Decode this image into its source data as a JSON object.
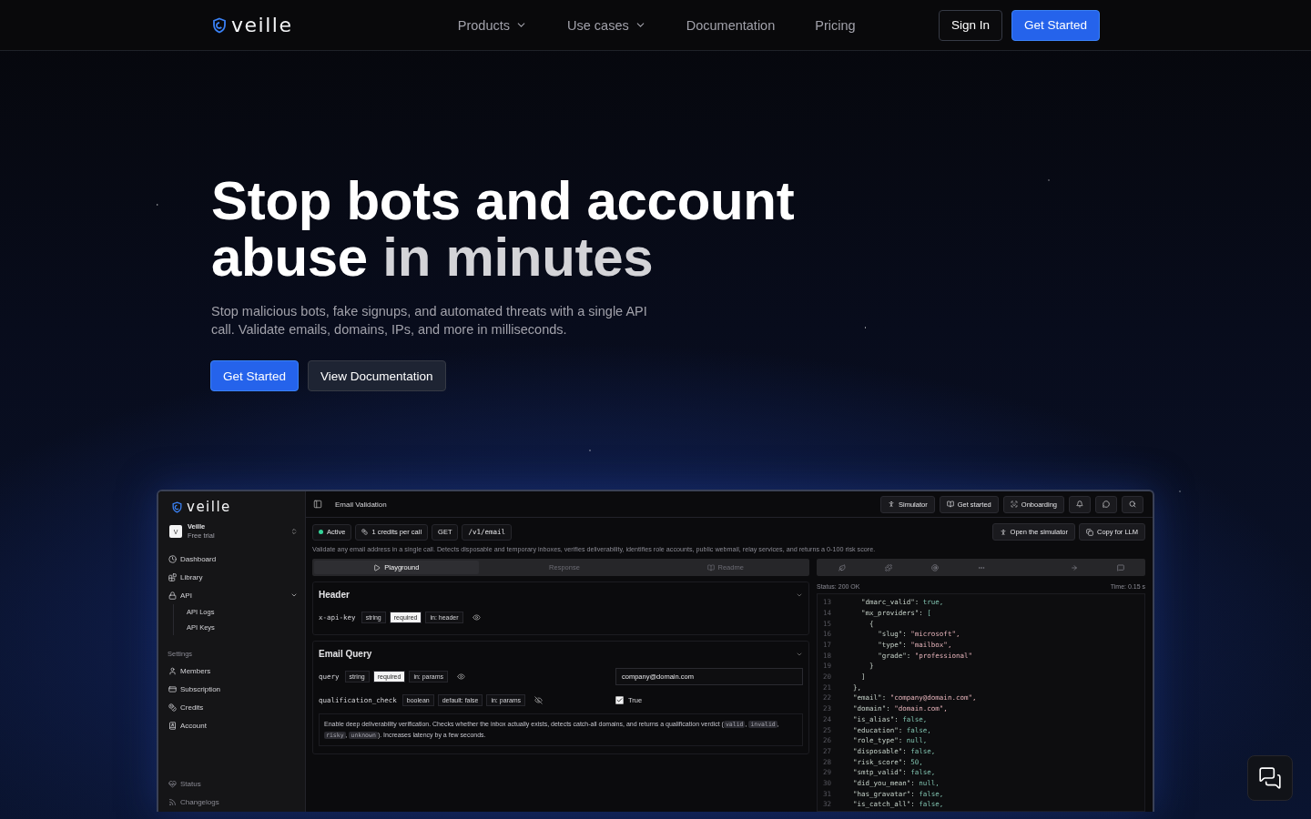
{
  "nav": {
    "logo": "veille",
    "links": [
      {
        "label": "Products",
        "dropdown": true
      },
      {
        "label": "Use cases",
        "dropdown": true
      },
      {
        "label": "Documentation",
        "dropdown": false
      },
      {
        "label": "Pricing",
        "dropdown": false
      }
    ],
    "sign_in": "Sign In",
    "cta": "Get Started"
  },
  "hero": {
    "title": [
      {
        "text": "Stop bots and account abuse",
        "kind": "plain"
      },
      {
        "text": "in minutes",
        "kind": "highlight"
      }
    ],
    "subtitle": "Stop malicious bots, fake signups, and automated threats with a single API call. Validate emails, domains, IPs, and more in milliseconds.",
    "buttons": [
      {
        "label": "Get Started",
        "kind": "primary"
      },
      {
        "label": "View Documentation",
        "kind": "secondary"
      }
    ]
  },
  "app": {
    "sidebar": {
      "logo": "veille",
      "workspace": {
        "avatar": "V",
        "name": "Veille",
        "plan": "Free trial"
      },
      "items": [
        {
          "label": "Dashboard"
        },
        {
          "label": "Library"
        },
        {
          "label": "API",
          "expanded": true,
          "children": [
            {
              "label": "API Logs"
            },
            {
              "label": "API Keys"
            }
          ]
        }
      ],
      "settings_label": "Settings",
      "settings": [
        {
          "label": "Members"
        },
        {
          "label": "Subscription"
        },
        {
          "label": "Credits"
        },
        {
          "label": "Account"
        }
      ],
      "footer": [
        {
          "label": "Status"
        },
        {
          "label": "Changelogs"
        }
      ]
    },
    "topbar": {
      "title": "Email Validation",
      "buttons": [
        {
          "label": "Simulator"
        },
        {
          "label": "Get started"
        },
        {
          "label": "Onboarding"
        }
      ]
    },
    "badges": [
      {
        "kind": "status",
        "text": "Active"
      },
      {
        "kind": "credits",
        "text": "1 credits per call"
      },
      {
        "kind": "plain",
        "text": "GET"
      },
      {
        "kind": "mono",
        "text": "/v1/email"
      }
    ],
    "actions": [
      {
        "label": "Open the simulator"
      },
      {
        "label": "Copy for LLM"
      }
    ],
    "description": "Validate any email address in a single call. Detects disposable and temporary inboxes, verifies deliverability, identifies role accounts, public webmail, relay services, and returns a 0-100 risk score.",
    "tabs": [
      {
        "label": "Playground",
        "selected": true
      },
      {
        "label": "Response",
        "selected": false
      },
      {
        "label": "Readme",
        "selected": false
      }
    ],
    "sections": [
      {
        "title": "Header",
        "params": [
          {
            "name": "x-api-key",
            "tags": [
              {
                "text": "string",
                "kind": "plain"
              },
              {
                "text": "required",
                "kind": "required"
              },
              {
                "text": "in: header",
                "kind": "plain"
              }
            ],
            "visible": true
          }
        ]
      },
      {
        "title": "Email Query",
        "params": [
          {
            "name": "query",
            "tags": [
              {
                "text": "string",
                "kind": "plain"
              },
              {
                "text": "required",
                "kind": "required"
              },
              {
                "text": "in: params",
                "kind": "plain"
              }
            ],
            "visible": true,
            "kind": "text",
            "value": "company@domain.com"
          },
          {
            "name": "qualification_check",
            "tags": [
              {
                "text": "boolean",
                "kind": "plain"
              },
              {
                "text": "default: false",
                "kind": "plain"
              },
              {
                "text": "in: params",
                "kind": "plain"
              }
            ],
            "visible": false,
            "kind": "checkbox",
            "checked": true,
            "check_label": "True",
            "description": [
              {
                "kind": "text",
                "text": "Enable deep deliverability verification. Checks whether the inbox actually exists, detects catch-all domains, and returns a qualification verdict ("
              },
              {
                "kind": "code",
                "text": "valid"
              },
              {
                "kind": "text",
                "text": ", "
              },
              {
                "kind": "code",
                "text": "invalid"
              },
              {
                "kind": "text",
                "text": ", "
              },
              {
                "kind": "code",
                "text": "risky"
              },
              {
                "kind": "text",
                "text": ", "
              },
              {
                "kind": "code",
                "text": "unknown"
              },
              {
                "kind": "text",
                "text": "). Increases latency by a few seconds."
              }
            ]
          }
        ]
      }
    ],
    "response": {
      "status": "Status: 200 OK",
      "time": "Time: 0.15 s",
      "lines": [
        {
          "num": "13",
          "text": "    \"dmarc_valid\": true,"
        },
        {
          "num": "14",
          "text": "    \"mx_providers\": ["
        },
        {
          "num": "15",
          "text": "      {"
        },
        {
          "num": "16",
          "text": "        \"slug\": \"microsoft\","
        },
        {
          "num": "17",
          "text": "        \"type\": \"mailbox\","
        },
        {
          "num": "18",
          "text": "        \"grade\": \"professional\""
        },
        {
          "num": "19",
          "text": "      }"
        },
        {
          "num": "20",
          "text": "    ]"
        },
        {
          "num": "21",
          "text": "  },"
        },
        {
          "num": "22",
          "text": "  \"email\": \"company@domain.com\","
        },
        {
          "num": "23",
          "text": "  \"domain\": \"domain.com\","
        },
        {
          "num": "24",
          "text": "  \"is_alias\": false,"
        },
        {
          "num": "25",
          "text": "  \"education\": false,"
        },
        {
          "num": "26",
          "text": "  \"role_type\": null,"
        },
        {
          "num": "27",
          "text": "  \"disposable\": false,"
        },
        {
          "num": "28",
          "text": "  \"risk_score\": 50,"
        },
        {
          "num": "29",
          "text": "  \"smtp_valid\": false,"
        },
        {
          "num": "30",
          "text": "  \"did_you_mean\": null,"
        },
        {
          "num": "31",
          "text": "  \"has_gravatar\": false,"
        },
        {
          "num": "32",
          "text": "  \"is_catch_all\": false,"
        }
      ]
    }
  }
}
